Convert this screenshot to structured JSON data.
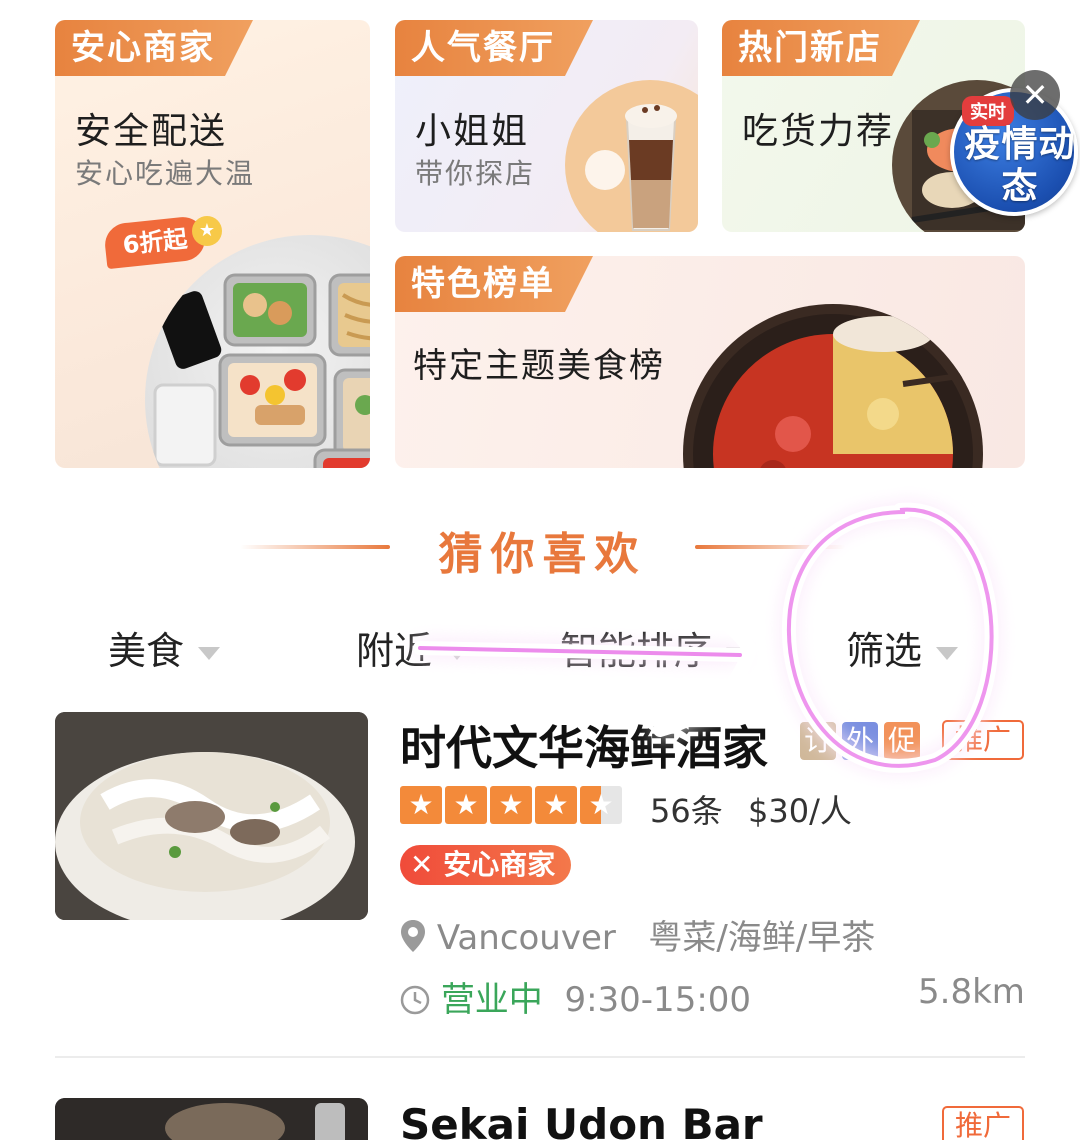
{
  "cards": {
    "anxin": {
      "tag": "安心商家",
      "title": "安全配送",
      "subtitle": "安心吃遍大温",
      "badge": "6折起"
    },
    "renqi": {
      "tag": "人气餐厅",
      "title": "小姐姐",
      "subtitle": "带你探店"
    },
    "remen": {
      "tag": "热门新店",
      "title": "吃货力荐"
    },
    "bangdan": {
      "tag": "特色榜单",
      "title": "特定主题美食榜"
    }
  },
  "floating_badge": {
    "live": "实时",
    "title": "疫情动态",
    "close_icon": "close-icon"
  },
  "section": {
    "title": "猜你喜欢"
  },
  "filters": [
    {
      "label": "美食",
      "icon": "triangle-down-icon"
    },
    {
      "label": "附近",
      "icon": "triangle-down-icon"
    },
    {
      "label": "智能排序",
      "icon": "triangle-down-icon"
    },
    {
      "label": "筛选",
      "icon": "triangle-down-icon"
    }
  ],
  "restaurants": [
    {
      "name": "时代文华海鲜酒家",
      "tags": [
        "订",
        "外",
        "促"
      ],
      "ad_label": "推广",
      "rating_stars": 4.5,
      "reviews": "56条",
      "price": "$30/人",
      "badge": "安心商家",
      "location": "Vancouver",
      "cuisine": "粤菜/海鲜/早茶",
      "status": "营业中",
      "hours": "9:30-15:00",
      "distance": "5.8km"
    },
    {
      "name": "Sekai Udon Bar",
      "ad_label": "推广"
    }
  ],
  "colors": {
    "accent": "#e8783c",
    "open_green": "#3aa65a",
    "ad_orange": "#f06a3a",
    "annotation": "#e040e0"
  }
}
